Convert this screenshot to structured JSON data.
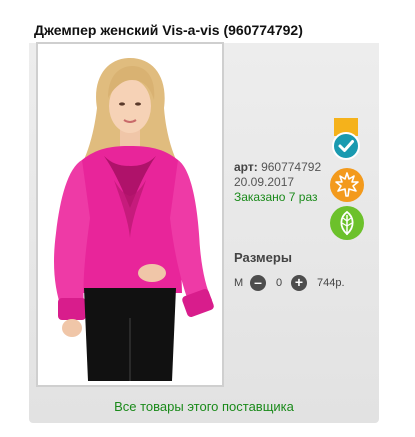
{
  "product": {
    "title": "Джемпер женский Vis-a-vis (960774792)",
    "art_label": "арт:",
    "art_value": "960774792",
    "date": "20.09.2017",
    "ordered": "Заказано 7 раз"
  },
  "sizes": {
    "label": "Размеры",
    "items": [
      {
        "size": "M",
        "qty": "0",
        "price": "744р."
      }
    ]
  },
  "footer": {
    "link": "Все товары этого поставщика"
  },
  "icons": {
    "check_badge": "check-ribbon-icon",
    "autumn": "maple-leaf-icon",
    "spring": "leaf-icon"
  },
  "colors": {
    "ordered_text": "#1a8a1a",
    "check_badge": "#1a9ab0",
    "ribbon": "#f5b21b",
    "autumn_badge": "#f39a1c",
    "spring_badge": "#6cc12b"
  }
}
